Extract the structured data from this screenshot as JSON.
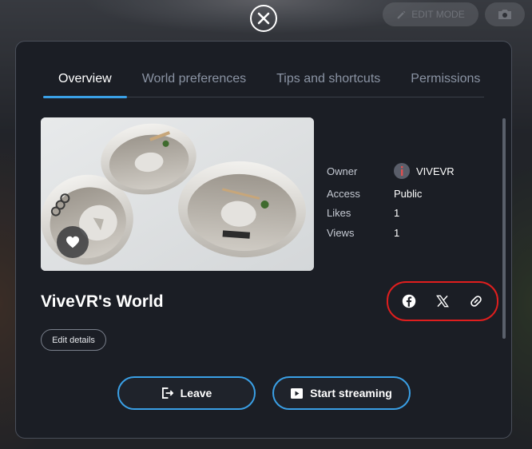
{
  "background": {
    "edit_mode_label": "EDIT MODE"
  },
  "modal": {
    "tabs": [
      {
        "label": "Overview",
        "active": true
      },
      {
        "label": "World preferences",
        "active": false
      },
      {
        "label": "Tips and shortcuts",
        "active": false
      },
      {
        "label": "Permissions",
        "active": false
      }
    ],
    "world": {
      "title": "ViveVR's World",
      "owner_label": "Owner",
      "owner_value": "VIVEVR",
      "access_label": "Access",
      "access_value": "Public",
      "likes_label": "Likes",
      "likes_value": "1",
      "views_label": "Views",
      "views_value": "1"
    },
    "share_icons": [
      "facebook-icon",
      "x-icon",
      "link-icon"
    ],
    "edit_details_label": "Edit details",
    "leave_label": "Leave",
    "start_streaming_label": "Start streaming"
  },
  "colors": {
    "accent": "#3aa0e6",
    "highlight": "#e01e1e",
    "panel": "#1b1e25"
  }
}
